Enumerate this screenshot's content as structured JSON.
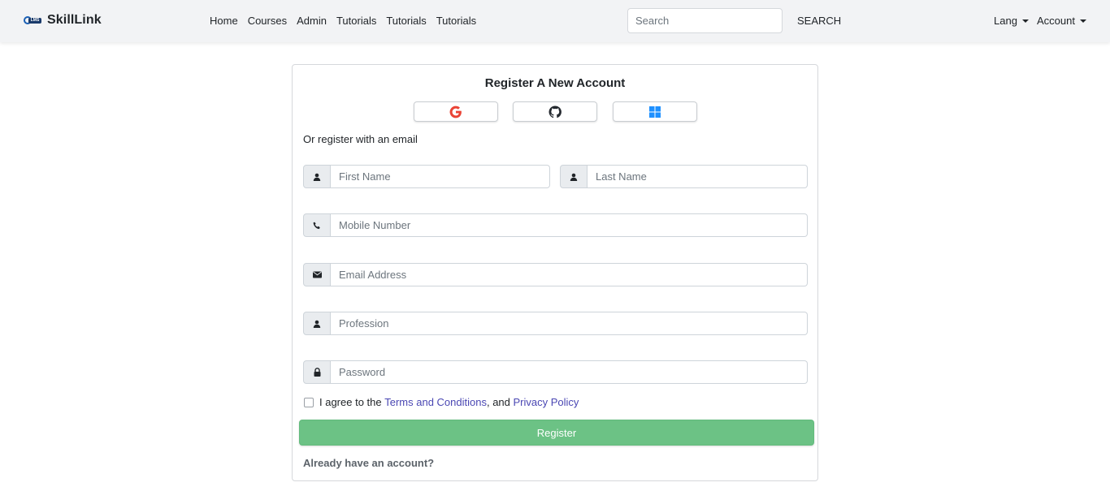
{
  "brand": {
    "logo_text": "LMS",
    "name": "SkillLink"
  },
  "nav": {
    "links": [
      "Home",
      "Courses",
      "Admin",
      "Tutorials",
      "Tutorials",
      "Tutorials"
    ],
    "search_placeholder": "Search",
    "search_button": "SEARCH",
    "lang_label": "Lang",
    "account_label": "Account"
  },
  "form": {
    "title": "Register A New Account",
    "social": [
      {
        "name": "google-icon",
        "color": "#ea4335"
      },
      {
        "name": "github-icon",
        "color": "#24292f"
      },
      {
        "name": "windows-icon",
        "color": "#1e90ff"
      }
    ],
    "or_text": "Or register with an email",
    "first_name_placeholder": "First Name",
    "last_name_placeholder": "Last Name",
    "mobile_placeholder": "Mobile Number",
    "email_placeholder": "Email Address",
    "profession_placeholder": "Profession",
    "password_placeholder": "Password",
    "agree_prefix": "I agree to the ",
    "terms_link": "Terms and Conditions",
    "agree_middle": ", and ",
    "privacy_link": "Privacy Policy",
    "register_button": "Register",
    "already_text": "Already have an account?",
    "register_color": "#6cc285"
  }
}
